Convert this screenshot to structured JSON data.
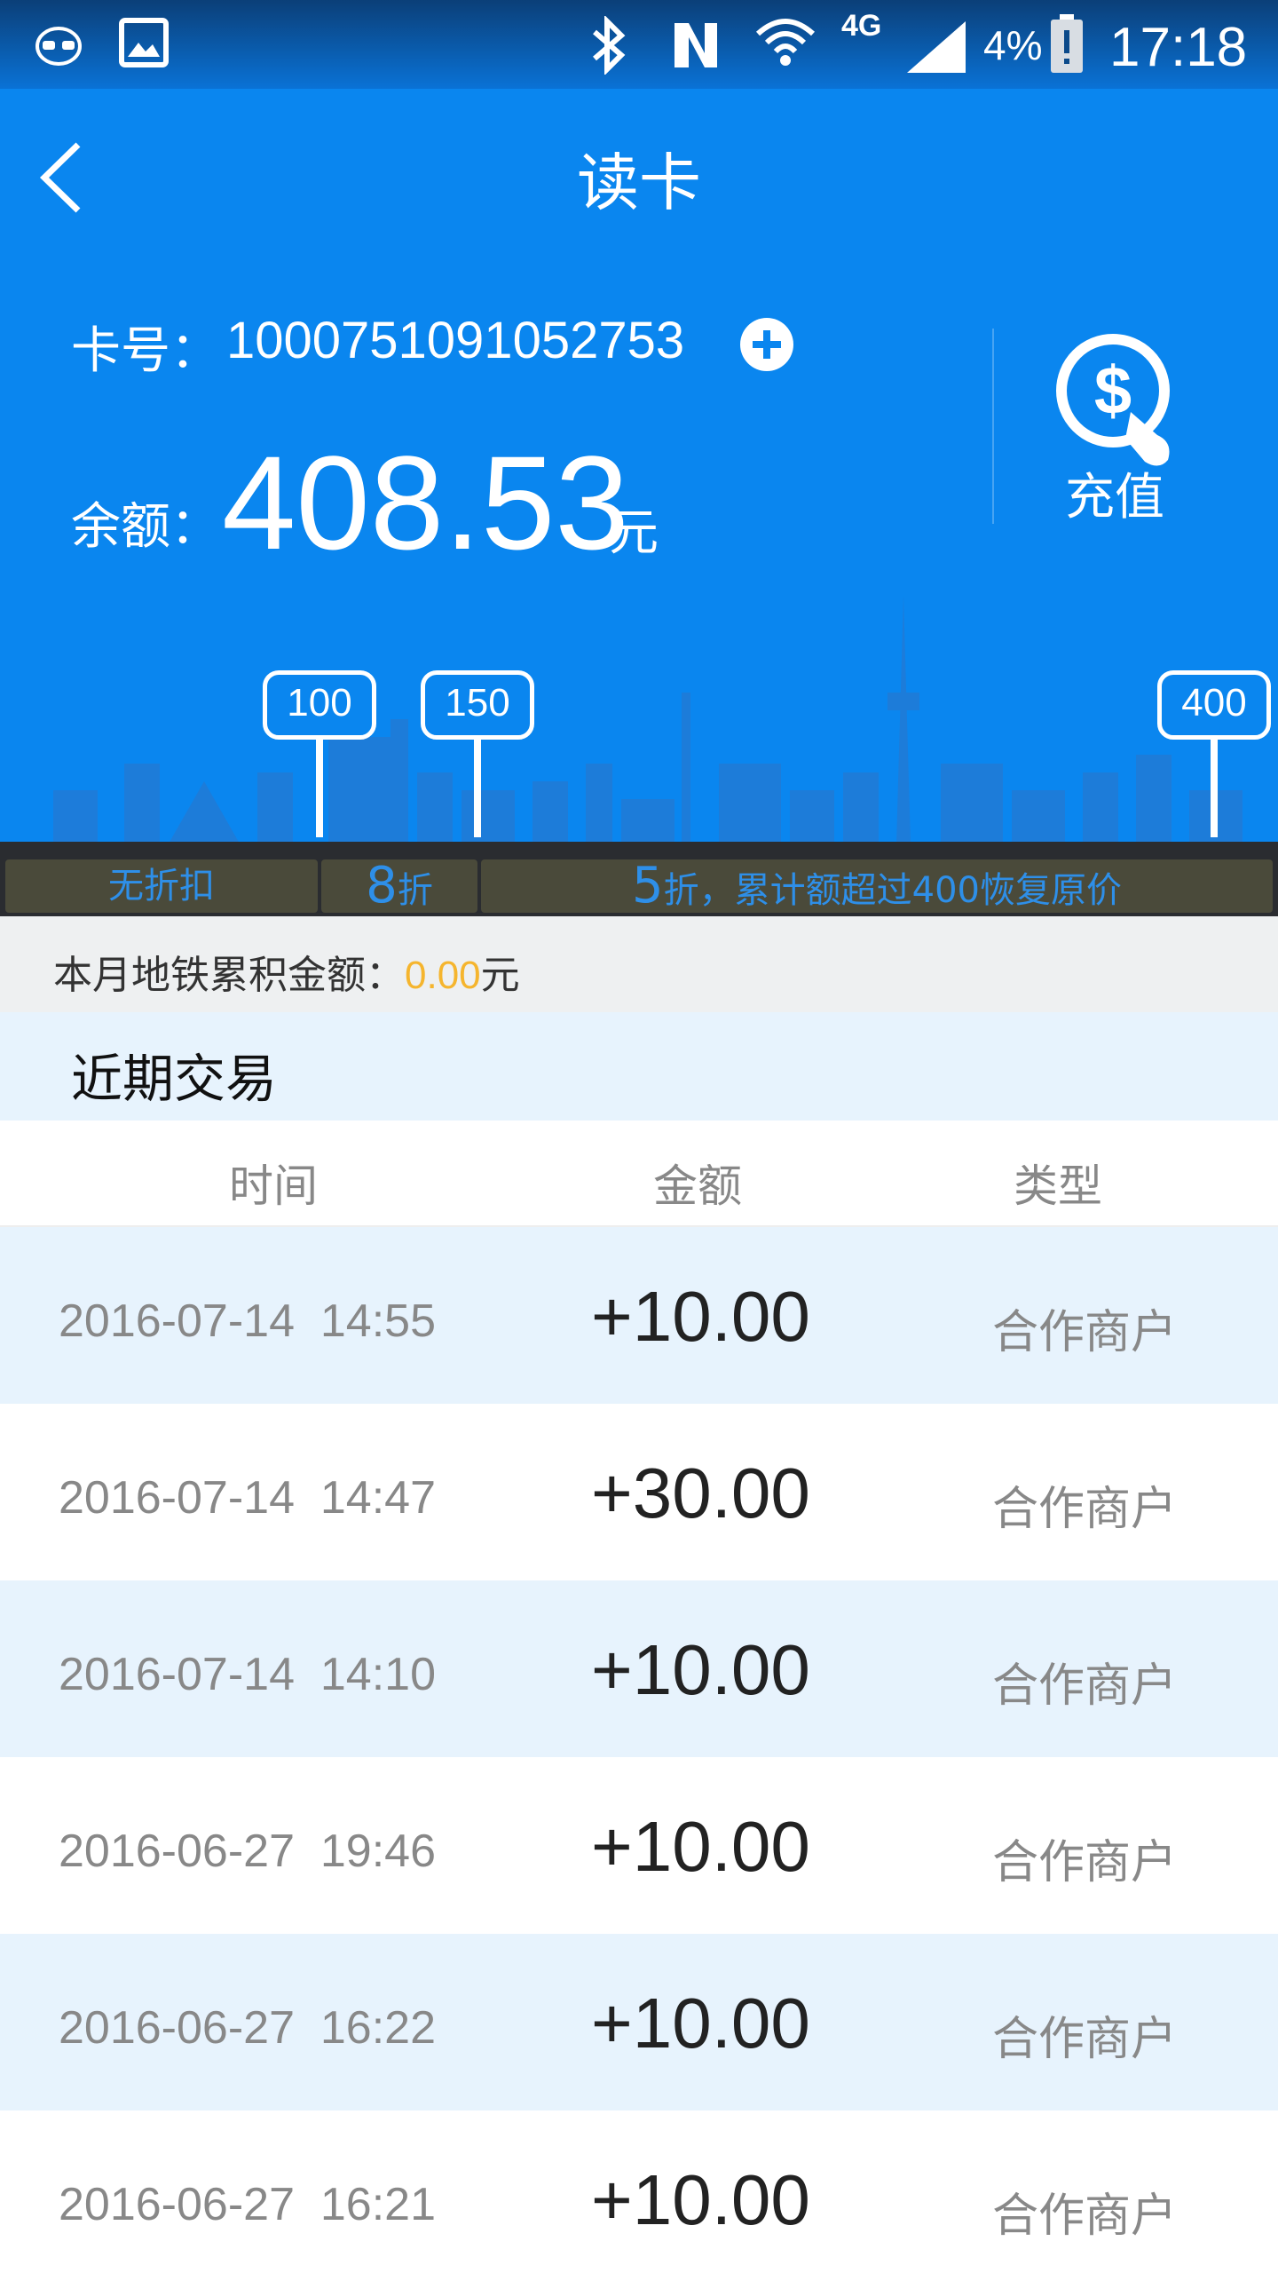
{
  "status_bar": {
    "battery": "4%",
    "network": "4G",
    "time": "17:18"
  },
  "header": {
    "title": "读卡",
    "card_label": "卡号：",
    "card_number": "1000751091052753",
    "balance_label": "余额：",
    "balance_value": "408.53",
    "balance_unit": "元",
    "recharge_label": "充值"
  },
  "pins": [
    "100",
    "150",
    "400"
  ],
  "discounts": {
    "tier1": "无折扣",
    "tier2_num": "8",
    "tier2_unit": "折",
    "tier3_num": "5",
    "tier3_text": "折，累计额超过400恢复原价"
  },
  "metro": {
    "label": "本月地铁累积金额：",
    "value": "0.00",
    "unit": "元"
  },
  "recent": {
    "title": "近期交易",
    "columns": [
      "时间",
      "金额",
      "类型"
    ],
    "rows": [
      {
        "time": "2016-07-14  14:55",
        "amount": "+10.00",
        "type": "合作商户"
      },
      {
        "time": "2016-07-14  14:47",
        "amount": "+30.00",
        "type": "合作商户"
      },
      {
        "time": "2016-07-14  14:10",
        "amount": "+10.00",
        "type": "合作商户"
      },
      {
        "time": "2016-06-27  19:46",
        "amount": "+10.00",
        "type": "合作商户"
      },
      {
        "time": "2016-06-27  16:22",
        "amount": "+10.00",
        "type": "合作商户"
      },
      {
        "time": "2016-06-27  16:21",
        "amount": "+10.00",
        "type": "合作商户"
      }
    ]
  },
  "colors": {
    "primary": "#0a86ef",
    "accent_orange": "#f5b52e",
    "row_alt": "#e7f3fd"
  }
}
